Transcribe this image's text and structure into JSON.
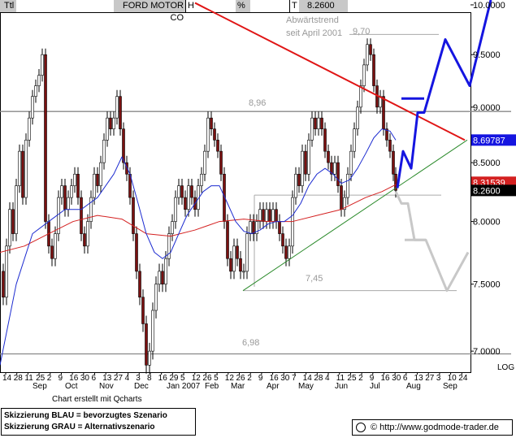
{
  "header": {
    "left_label": "Ttl",
    "title": "FORD MOTOR CO",
    "h_label": "H",
    "pct_label": "%",
    "t_label": "T",
    "last_value": "8.2600"
  },
  "footer": {
    "credit": "Chart erstellt mit Qcharts",
    "legend_line1": "Skizzierung BLAU = bevorzugtes Szenario",
    "legend_line2": "Skizzierung GRAU = Alternativszenario",
    "url": "© http://www.godmode-trader.de"
  },
  "chart_data": {
    "type": "line",
    "ylim": [
      6.85,
      10.05
    ],
    "yticks": [
      "10.0000",
      "9.5000",
      "9.0000",
      "8.5000",
      "8.0000",
      "7.5000",
      "7.0000"
    ],
    "ytick_values": [
      10.0,
      9.5,
      9.0,
      8.5,
      8.0,
      7.5,
      7.0
    ],
    "x_day_labels": [
      "14",
      "28",
      "11",
      "25",
      "2",
      "9",
      "16",
      "30",
      "6",
      "13",
      "27",
      "4",
      "3",
      "8",
      "16",
      "29",
      "5",
      "12",
      "26",
      "5",
      "12",
      "26",
      "2",
      "9",
      "16",
      "30",
      "7",
      "14",
      "28",
      "4",
      "11",
      "25",
      "2",
      "9",
      "16",
      "30",
      "6",
      "13",
      "27",
      "3",
      "10",
      "24"
    ],
    "x_month_labels": [
      "Sep",
      "Oct",
      "Nov",
      "Dec",
      "Jan 2007",
      "Feb",
      "Mar",
      "Apr",
      "May",
      "Jun",
      "Jul",
      "Aug",
      "Sep"
    ],
    "log_label": "LOG",
    "price_labels": {
      "last": "8.2600",
      "trend": "8.69787",
      "ma": "8.31539"
    },
    "annotations": {
      "downtrend_line1": "Abwärtstrend",
      "downtrend_line2": "seit April 2001",
      "high": "9,70",
      "resistance": "8,96",
      "support": "7,45",
      "low": "6,98"
    },
    "levels": [
      8.96,
      7.45,
      6.98
    ],
    "level_70": 9.7,
    "level_822": 8.22,
    "colors": {
      "candle_up": "#ffffff",
      "candle_down": "#7a1010",
      "ma_fast": "#1c2bd0",
      "ma_slow": "#d42020",
      "trend_down": "#e01515",
      "trend_up": "#2a8a2a",
      "scenario_blue": "#1515e0",
      "scenario_gray": "#c8c8c8",
      "price_box_last": "#000000",
      "price_box_trend": "#1515e0",
      "price_box_ma": "#d42020"
    },
    "close_path": [
      [
        0,
        7.6
      ],
      [
        4,
        7.4
      ],
      [
        8,
        7.8
      ],
      [
        12,
        8.1
      ],
      [
        16,
        7.9
      ],
      [
        20,
        8.3
      ],
      [
        24,
        8.6
      ],
      [
        28,
        8.2
      ],
      [
        32,
        8.7
      ],
      [
        36,
        8.9
      ],
      [
        40,
        9.1
      ],
      [
        44,
        9.2
      ],
      [
        48,
        9.3
      ],
      [
        52,
        9.5
      ],
      [
        56,
        8.0
      ],
      [
        60,
        7.8
      ],
      [
        64,
        7.7
      ],
      [
        68,
        7.9
      ],
      [
        72,
        8.2
      ],
      [
        76,
        8.3
      ],
      [
        80,
        8.1
      ],
      [
        84,
        8.2
      ],
      [
        88,
        8.3
      ],
      [
        92,
        8.4
      ],
      [
        96,
        8.2
      ],
      [
        100,
        7.9
      ],
      [
        104,
        7.8
      ],
      [
        108,
        8.0
      ],
      [
        112,
        8.2
      ],
      [
        116,
        8.4
      ],
      [
        120,
        8.3
      ],
      [
        124,
        8.5
      ],
      [
        128,
        8.7
      ],
      [
        132,
        8.9
      ],
      [
        136,
        8.8
      ],
      [
        140,
        8.9
      ],
      [
        144,
        9.1
      ],
      [
        148,
        8.8
      ],
      [
        152,
        8.5
      ],
      [
        156,
        8.4
      ],
      [
        160,
        8.2
      ],
      [
        164,
        7.9
      ],
      [
        168,
        7.6
      ],
      [
        172,
        7.4
      ],
      [
        176,
        7.2
      ],
      [
        180,
        6.9
      ],
      [
        184,
        7.0
      ],
      [
        188,
        7.3
      ],
      [
        192,
        7.5
      ],
      [
        196,
        7.6
      ],
      [
        200,
        7.5
      ],
      [
        204,
        7.7
      ],
      [
        208,
        7.9
      ],
      [
        212,
        8.0
      ],
      [
        216,
        8.2
      ],
      [
        220,
        8.3
      ],
      [
        224,
        8.2
      ],
      [
        228,
        8.1
      ],
      [
        232,
        8.3
      ],
      [
        236,
        8.2
      ],
      [
        240,
        8.1
      ],
      [
        244,
        8.3
      ],
      [
        248,
        8.4
      ],
      [
        252,
        8.6
      ],
      [
        256,
        8.9
      ],
      [
        260,
        8.8
      ],
      [
        264,
        8.7
      ],
      [
        268,
        8.6
      ],
      [
        272,
        8.4
      ],
      [
        276,
        8.0
      ],
      [
        280,
        7.7
      ],
      [
        284,
        7.6
      ],
      [
        288,
        7.8
      ],
      [
        292,
        7.7
      ],
      [
        296,
        7.6
      ],
      [
        300,
        7.6
      ],
      [
        304,
        7.9
      ],
      [
        308,
        8.0
      ],
      [
        312,
        7.9
      ],
      [
        316,
        8.0
      ],
      [
        320,
        8.1
      ],
      [
        324,
        8.0
      ],
      [
        328,
        8.1
      ],
      [
        332,
        8.0
      ],
      [
        336,
        8.1
      ],
      [
        340,
        8.0
      ],
      [
        344,
        7.9
      ],
      [
        348,
        7.8
      ],
      [
        352,
        7.7
      ],
      [
        356,
        7.8
      ],
      [
        360,
        8.2
      ],
      [
        364,
        8.4
      ],
      [
        368,
        8.3
      ],
      [
        372,
        8.6
      ],
      [
        376,
        8.4
      ],
      [
        380,
        8.7
      ],
      [
        384,
        8.9
      ],
      [
        388,
        8.8
      ],
      [
        392,
        8.9
      ],
      [
        396,
        8.8
      ],
      [
        400,
        8.6
      ],
      [
        404,
        8.5
      ],
      [
        408,
        8.4
      ],
      [
        412,
        8.5
      ],
      [
        416,
        8.3
      ],
      [
        420,
        8.1
      ],
      [
        424,
        8.2
      ],
      [
        428,
        8.4
      ],
      [
        432,
        8.6
      ],
      [
        436,
        8.8
      ],
      [
        440,
        9.0
      ],
      [
        444,
        9.2
      ],
      [
        448,
        9.4
      ],
      [
        452,
        9.6
      ],
      [
        456,
        9.5
      ],
      [
        460,
        9.2
      ],
      [
        464,
        9.0
      ],
      [
        468,
        9.1
      ],
      [
        472,
        8.8
      ],
      [
        476,
        8.7
      ],
      [
        480,
        8.6
      ],
      [
        484,
        8.4
      ],
      [
        487,
        8.26
      ]
    ],
    "ma_fast_path": [
      [
        0,
        6.9
      ],
      [
        20,
        7.5
      ],
      [
        40,
        7.9
      ],
      [
        60,
        8.0
      ],
      [
        80,
        8.1
      ],
      [
        100,
        8.1
      ],
      [
        120,
        8.2
      ],
      [
        140,
        8.4
      ],
      [
        150,
        8.55
      ],
      [
        160,
        8.4
      ],
      [
        170,
        8.15
      ],
      [
        180,
        7.9
      ],
      [
        190,
        7.75
      ],
      [
        200,
        7.7
      ],
      [
        210,
        7.75
      ],
      [
        220,
        7.9
      ],
      [
        230,
        8.05
      ],
      [
        240,
        8.15
      ],
      [
        250,
        8.25
      ],
      [
        260,
        8.3
      ],
      [
        270,
        8.3
      ],
      [
        280,
        8.15
      ],
      [
        290,
        8.0
      ],
      [
        300,
        7.92
      ],
      [
        310,
        7.9
      ],
      [
        320,
        7.93
      ],
      [
        330,
        7.98
      ],
      [
        340,
        8.0
      ],
      [
        350,
        8.0
      ],
      [
        360,
        8.05
      ],
      [
        370,
        8.15
      ],
      [
        380,
        8.3
      ],
      [
        390,
        8.4
      ],
      [
        400,
        8.45
      ],
      [
        410,
        8.4
      ],
      [
        420,
        8.32
      ],
      [
        430,
        8.35
      ],
      [
        440,
        8.45
      ],
      [
        450,
        8.58
      ],
      [
        460,
        8.72
      ],
      [
        470,
        8.8
      ],
      [
        480,
        8.78
      ],
      [
        487,
        8.7
      ]
    ],
    "ma_slow_path": [
      [
        0,
        7.75
      ],
      [
        30,
        7.8
      ],
      [
        60,
        7.9
      ],
      [
        90,
        8.0
      ],
      [
        120,
        8.05
      ],
      [
        150,
        8.02
      ],
      [
        180,
        7.9
      ],
      [
        210,
        7.88
      ],
      [
        240,
        7.93
      ],
      [
        270,
        8.0
      ],
      [
        300,
        8.02
      ],
      [
        330,
        8.0
      ],
      [
        360,
        8.0
      ],
      [
        390,
        8.05
      ],
      [
        420,
        8.1
      ],
      [
        450,
        8.2
      ],
      [
        470,
        8.25
      ],
      [
        487,
        8.31
      ]
    ],
    "downtrend": [
      [
        240,
        10.02
      ],
      [
        572,
        8.7
      ]
    ],
    "uptrend": [
      [
        299,
        7.45
      ],
      [
        575,
        8.7
      ]
    ],
    "blue_scenario": [
      [
        489,
        8.28
      ],
      [
        496,
        8.6
      ],
      [
        506,
        8.45
      ],
      [
        514,
        8.95
      ],
      [
        522,
        8.95
      ],
      [
        548,
        9.65
      ],
      [
        578,
        9.2
      ],
      [
        604,
        10.05
      ]
    ],
    "blue_flag": [
      [
        494,
        9.08
      ],
      [
        522,
        9.08
      ]
    ],
    "gray_scenario": [
      [
        487,
        8.25
      ],
      [
        494,
        8.15
      ],
      [
        502,
        8.15
      ],
      [
        510,
        7.85
      ],
      [
        524,
        7.85
      ],
      [
        550,
        7.45
      ],
      [
        576,
        7.75
      ]
    ],
    "gray_flag": [
      [
        498,
        7.85
      ],
      [
        524,
        7.85
      ]
    ]
  }
}
